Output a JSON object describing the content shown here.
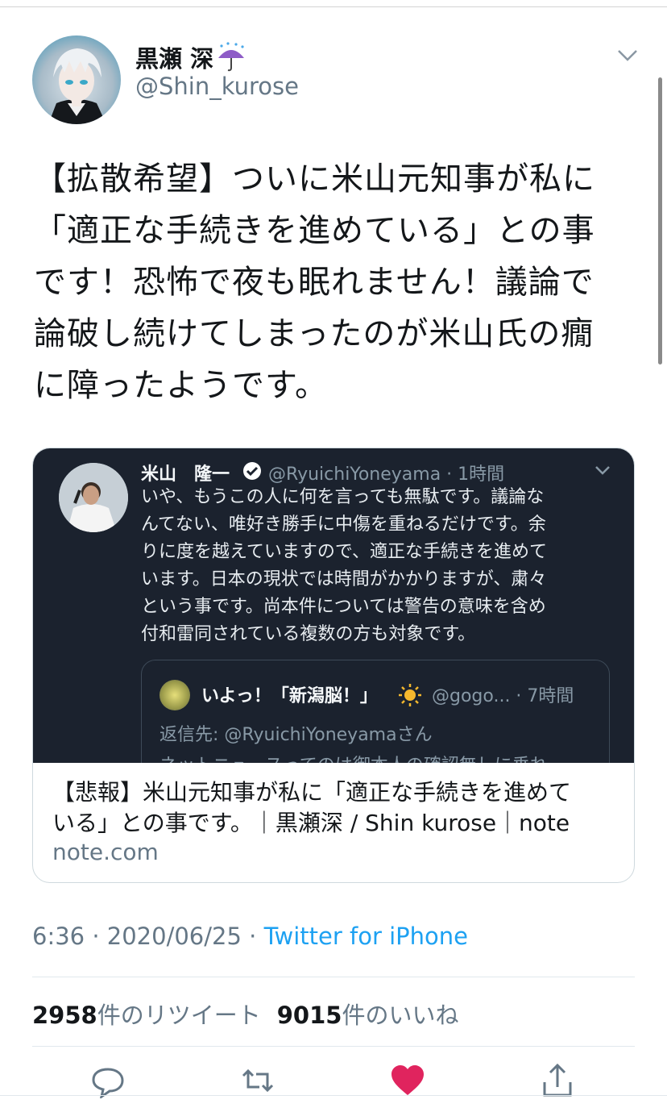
{
  "tweet": {
    "display_name": "黒瀬 深",
    "name_emoji": "umbrella-with-rain-icon",
    "handle": "@Shin_kurose",
    "text": "【拡散希望】ついに米山元知事が私に\n「適正な手続きを進めている」との事\nです！恐怖で夜も眠れません！議論で\n論破し続けてしまったのが米山氏の癇\nに障ったようです。"
  },
  "card": {
    "quoted": {
      "name": "米山　隆一",
      "handle_time": "@RyuichiYoneyama · 1時間",
      "text": "いや、もうこの人に何を言っても無駄です。議論な\nんてない、唯好き勝手に中傷を重ねるだけです。余\nりに度を越えていますので、適正な手続きを進めて\nいます。日本の現状では時間がかかりますが、粛々\nという事です。尚本件については警告の意味を含め\n付和雷同されている複数の方も対象です。",
      "inner": {
        "name": "いよっ！「新潟脳！」",
        "handle_time": "@gogo... · 7時間",
        "reply_to": "返信先: @RyuichiYoneyamaさん",
        "cut_text": "ネットニュースってのは御本人の確認無しに垂れ"
      }
    },
    "title": "【悲報】米山元知事が私に「適正な手続きを進めて\nいる」との事です。｜黒瀬深 / Shin kurose｜note",
    "domain": "note.com"
  },
  "meta": {
    "time_date": "6:36 · 2020/06/25 · ",
    "source": "Twitter for iPhone"
  },
  "stats": {
    "retweets": "2958",
    "retweets_label": "件のリツイート",
    "likes": "9015",
    "likes_label": "件のいいね"
  },
  "colors": {
    "link": "#1da1f2",
    "like": "#e0245e",
    "card_dark": "#1b222e",
    "secondary_text": "#657786"
  }
}
